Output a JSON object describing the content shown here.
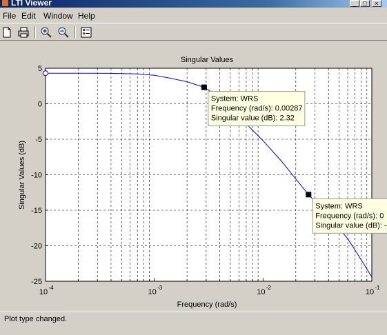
{
  "window": {
    "title": "LTI Viewer",
    "minimize_icon": "minimize-icon",
    "maximize_icon": "maximize-icon",
    "close_icon": "close-icon"
  },
  "menu": [
    "File",
    "Edit",
    "Window",
    "Help"
  ],
  "toolbar": {
    "icons": [
      "new-figure-icon",
      "print-icon",
      "zoom-in-icon",
      "zoom-out-icon",
      "plot-config-icon"
    ]
  },
  "plot": {
    "title": "Singular Values",
    "xlabel": "Frequency (rad/s)",
    "ylabel": "Singular Values (dB)",
    "x_ticks": [
      {
        "base": "10",
        "exp": "-4"
      },
      {
        "base": "10",
        "exp": "-3"
      },
      {
        "base": "10",
        "exp": "-2"
      },
      {
        "base": "10",
        "exp": "-1"
      }
    ],
    "y_ticks": [
      "5",
      "0",
      "-5",
      "-10",
      "-15",
      "-20",
      "-25"
    ],
    "datatips": [
      {
        "lines": [
          "System: WRS",
          "Frequency (rad/s): 0.00287",
          "Singular value (dB): 2.32"
        ]
      },
      {
        "lines": [
          "System: WRS",
          "Frequency (rad/s): 0",
          "Singular value (dB): -"
        ]
      }
    ]
  },
  "chart_data": {
    "type": "line",
    "title": "Singular Values",
    "xlabel": "Frequency (rad/s)",
    "ylabel": "Singular Values (dB)",
    "xscale": "log",
    "xlim": [
      0.0001,
      0.1
    ],
    "ylim": [
      -25,
      5
    ],
    "grid": true,
    "series": [
      {
        "name": "WRS",
        "color": "#0000ff",
        "x": [
          0.0001,
          0.0002,
          0.0004,
          0.0007,
          0.001,
          0.0014,
          0.002,
          0.00287,
          0.004,
          0.006,
          0.01,
          0.015,
          0.02,
          0.0262,
          0.04,
          0.06,
          0.08,
          0.1
        ],
        "y": [
          4.3,
          4.3,
          4.28,
          4.2,
          4.0,
          3.6,
          3.1,
          2.32,
          0.9,
          -1.8,
          -5.2,
          -8.2,
          -10.6,
          -12.8,
          -15.8,
          -19.0,
          -22.0,
          -24.4
        ]
      }
    ],
    "markers": [
      {
        "x": 0.0001,
        "y": 4.3,
        "style": "open-circle"
      },
      {
        "x": 0.00287,
        "y": 2.32,
        "style": "datatip"
      },
      {
        "x": 0.0262,
        "y": -12.8,
        "style": "datatip"
      }
    ]
  },
  "status": {
    "text": "Plot type changed."
  }
}
